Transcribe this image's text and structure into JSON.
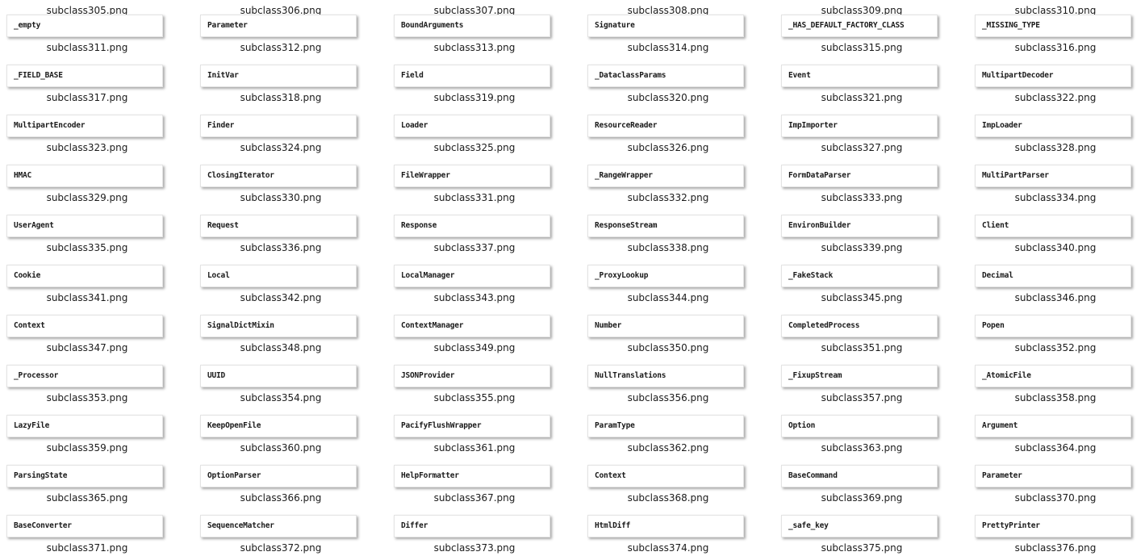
{
  "partial_top_row": [
    "subclass305.png",
    "subclass306.png",
    "subclass307.png",
    "subclass308.png",
    "subclass309.png",
    "subclass310.png"
  ],
  "files": [
    {
      "thumb": "_empty",
      "name": "subclass311.png"
    },
    {
      "thumb": "Parameter",
      "name": "subclass312.png"
    },
    {
      "thumb": "BoundArguments",
      "name": "subclass313.png"
    },
    {
      "thumb": "Signature",
      "name": "subclass314.png"
    },
    {
      "thumb": "_HAS_DEFAULT_FACTORY_CLASS",
      "name": "subclass315.png"
    },
    {
      "thumb": "_MISSING_TYPE",
      "name": "subclass316.png"
    },
    {
      "thumb": "_FIELD_BASE",
      "name": "subclass317.png"
    },
    {
      "thumb": "InitVar",
      "name": "subclass318.png"
    },
    {
      "thumb": "Field",
      "name": "subclass319.png"
    },
    {
      "thumb": "_DataclassParams",
      "name": "subclass320.png"
    },
    {
      "thumb": "Event",
      "name": "subclass321.png"
    },
    {
      "thumb": "MultipartDecoder",
      "name": "subclass322.png"
    },
    {
      "thumb": "MultipartEncoder",
      "name": "subclass323.png"
    },
    {
      "thumb": "Finder",
      "name": "subclass324.png"
    },
    {
      "thumb": "Loader",
      "name": "subclass325.png"
    },
    {
      "thumb": "ResourceReader",
      "name": "subclass326.png"
    },
    {
      "thumb": "ImpImporter",
      "name": "subclass327.png"
    },
    {
      "thumb": "ImpLoader",
      "name": "subclass328.png"
    },
    {
      "thumb": "HMAC",
      "name": "subclass329.png"
    },
    {
      "thumb": "ClosingIterator",
      "name": "subclass330.png"
    },
    {
      "thumb": "FileWrapper",
      "name": "subclass331.png"
    },
    {
      "thumb": "_RangeWrapper",
      "name": "subclass332.png"
    },
    {
      "thumb": "FormDataParser",
      "name": "subclass333.png"
    },
    {
      "thumb": "MultiPartParser",
      "name": "subclass334.png"
    },
    {
      "thumb": "UserAgent",
      "name": "subclass335.png"
    },
    {
      "thumb": "Request",
      "name": "subclass336.png"
    },
    {
      "thumb": "Response",
      "name": "subclass337.png"
    },
    {
      "thumb": "ResponseStream",
      "name": "subclass338.png"
    },
    {
      "thumb": "EnvironBuilder",
      "name": "subclass339.png"
    },
    {
      "thumb": "Client",
      "name": "subclass340.png"
    },
    {
      "thumb": "Cookie",
      "name": "subclass341.png"
    },
    {
      "thumb": "Local",
      "name": "subclass342.png"
    },
    {
      "thumb": "LocalManager",
      "name": "subclass343.png"
    },
    {
      "thumb": "_ProxyLookup",
      "name": "subclass344.png"
    },
    {
      "thumb": "_FakeStack",
      "name": "subclass345.png"
    },
    {
      "thumb": "Decimal",
      "name": "subclass346.png"
    },
    {
      "thumb": "Context",
      "name": "subclass347.png"
    },
    {
      "thumb": "SignalDictMixin",
      "name": "subclass348.png"
    },
    {
      "thumb": "ContextManager",
      "name": "subclass349.png"
    },
    {
      "thumb": "Number",
      "name": "subclass350.png"
    },
    {
      "thumb": "CompletedProcess",
      "name": "subclass351.png"
    },
    {
      "thumb": "Popen",
      "name": "subclass352.png"
    },
    {
      "thumb": "_Processor",
      "name": "subclass353.png"
    },
    {
      "thumb": "UUID",
      "name": "subclass354.png"
    },
    {
      "thumb": "JSONProvider",
      "name": "subclass355.png"
    },
    {
      "thumb": "NullTranslations",
      "name": "subclass356.png"
    },
    {
      "thumb": "_FixupStream",
      "name": "subclass357.png"
    },
    {
      "thumb": "_AtomicFile",
      "name": "subclass358.png"
    },
    {
      "thumb": "LazyFile",
      "name": "subclass359.png"
    },
    {
      "thumb": "KeepOpenFile",
      "name": "subclass360.png"
    },
    {
      "thumb": "PacifyFlushWrapper",
      "name": "subclass361.png"
    },
    {
      "thumb": "ParamType",
      "name": "subclass362.png"
    },
    {
      "thumb": "Option",
      "name": "subclass363.png"
    },
    {
      "thumb": "Argument",
      "name": "subclass364.png"
    },
    {
      "thumb": "ParsingState",
      "name": "subclass365.png"
    },
    {
      "thumb": "OptionParser",
      "name": "subclass366.png"
    },
    {
      "thumb": "HelpFormatter",
      "name": "subclass367.png"
    },
    {
      "thumb": "Context",
      "name": "subclass368.png"
    },
    {
      "thumb": "BaseCommand",
      "name": "subclass369.png"
    },
    {
      "thumb": "Parameter",
      "name": "subclass370.png"
    },
    {
      "thumb": "BaseConverter",
      "name": "subclass371.png"
    },
    {
      "thumb": "SequenceMatcher",
      "name": "subclass372.png"
    },
    {
      "thumb": "Differ",
      "name": "subclass373.png"
    },
    {
      "thumb": "HtmlDiff",
      "name": "subclass374.png"
    },
    {
      "thumb": "_safe_key",
      "name": "subclass375.png"
    },
    {
      "thumb": "PrettyPrinter",
      "name": "subclass376.png"
    }
  ]
}
